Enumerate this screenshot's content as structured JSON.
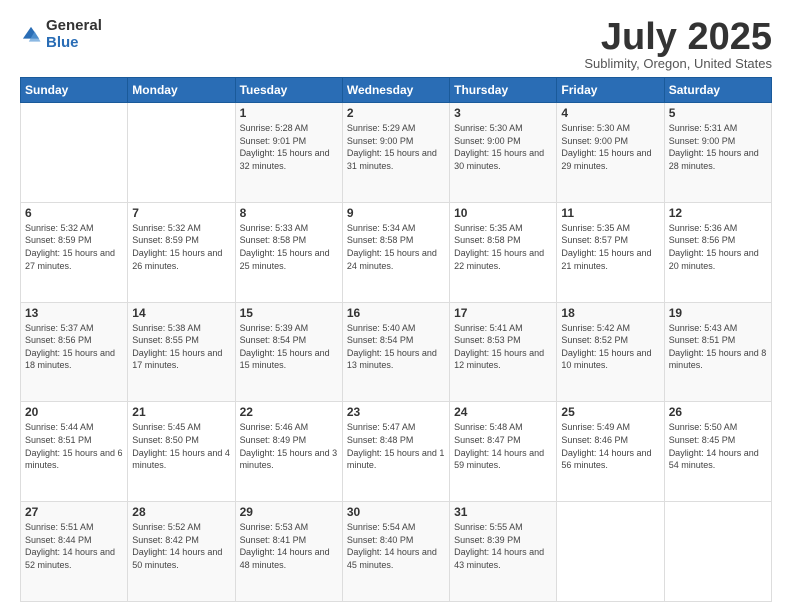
{
  "header": {
    "logo_general": "General",
    "logo_blue": "Blue",
    "month": "July 2025",
    "location": "Sublimity, Oregon, United States"
  },
  "days_of_week": [
    "Sunday",
    "Monday",
    "Tuesday",
    "Wednesday",
    "Thursday",
    "Friday",
    "Saturday"
  ],
  "weeks": [
    [
      {
        "day": "",
        "sunrise": "",
        "sunset": "",
        "daylight": ""
      },
      {
        "day": "",
        "sunrise": "",
        "sunset": "",
        "daylight": ""
      },
      {
        "day": "1",
        "sunrise": "Sunrise: 5:28 AM",
        "sunset": "Sunset: 9:01 PM",
        "daylight": "Daylight: 15 hours and 32 minutes."
      },
      {
        "day": "2",
        "sunrise": "Sunrise: 5:29 AM",
        "sunset": "Sunset: 9:00 PM",
        "daylight": "Daylight: 15 hours and 31 minutes."
      },
      {
        "day": "3",
        "sunrise": "Sunrise: 5:30 AM",
        "sunset": "Sunset: 9:00 PM",
        "daylight": "Daylight: 15 hours and 30 minutes."
      },
      {
        "day": "4",
        "sunrise": "Sunrise: 5:30 AM",
        "sunset": "Sunset: 9:00 PM",
        "daylight": "Daylight: 15 hours and 29 minutes."
      },
      {
        "day": "5",
        "sunrise": "Sunrise: 5:31 AM",
        "sunset": "Sunset: 9:00 PM",
        "daylight": "Daylight: 15 hours and 28 minutes."
      }
    ],
    [
      {
        "day": "6",
        "sunrise": "Sunrise: 5:32 AM",
        "sunset": "Sunset: 8:59 PM",
        "daylight": "Daylight: 15 hours and 27 minutes."
      },
      {
        "day": "7",
        "sunrise": "Sunrise: 5:32 AM",
        "sunset": "Sunset: 8:59 PM",
        "daylight": "Daylight: 15 hours and 26 minutes."
      },
      {
        "day": "8",
        "sunrise": "Sunrise: 5:33 AM",
        "sunset": "Sunset: 8:58 PM",
        "daylight": "Daylight: 15 hours and 25 minutes."
      },
      {
        "day": "9",
        "sunrise": "Sunrise: 5:34 AM",
        "sunset": "Sunset: 8:58 PM",
        "daylight": "Daylight: 15 hours and 24 minutes."
      },
      {
        "day": "10",
        "sunrise": "Sunrise: 5:35 AM",
        "sunset": "Sunset: 8:58 PM",
        "daylight": "Daylight: 15 hours and 22 minutes."
      },
      {
        "day": "11",
        "sunrise": "Sunrise: 5:35 AM",
        "sunset": "Sunset: 8:57 PM",
        "daylight": "Daylight: 15 hours and 21 minutes."
      },
      {
        "day": "12",
        "sunrise": "Sunrise: 5:36 AM",
        "sunset": "Sunset: 8:56 PM",
        "daylight": "Daylight: 15 hours and 20 minutes."
      }
    ],
    [
      {
        "day": "13",
        "sunrise": "Sunrise: 5:37 AM",
        "sunset": "Sunset: 8:56 PM",
        "daylight": "Daylight: 15 hours and 18 minutes."
      },
      {
        "day": "14",
        "sunrise": "Sunrise: 5:38 AM",
        "sunset": "Sunset: 8:55 PM",
        "daylight": "Daylight: 15 hours and 17 minutes."
      },
      {
        "day": "15",
        "sunrise": "Sunrise: 5:39 AM",
        "sunset": "Sunset: 8:54 PM",
        "daylight": "Daylight: 15 hours and 15 minutes."
      },
      {
        "day": "16",
        "sunrise": "Sunrise: 5:40 AM",
        "sunset": "Sunset: 8:54 PM",
        "daylight": "Daylight: 15 hours and 13 minutes."
      },
      {
        "day": "17",
        "sunrise": "Sunrise: 5:41 AM",
        "sunset": "Sunset: 8:53 PM",
        "daylight": "Daylight: 15 hours and 12 minutes."
      },
      {
        "day": "18",
        "sunrise": "Sunrise: 5:42 AM",
        "sunset": "Sunset: 8:52 PM",
        "daylight": "Daylight: 15 hours and 10 minutes."
      },
      {
        "day": "19",
        "sunrise": "Sunrise: 5:43 AM",
        "sunset": "Sunset: 8:51 PM",
        "daylight": "Daylight: 15 hours and 8 minutes."
      }
    ],
    [
      {
        "day": "20",
        "sunrise": "Sunrise: 5:44 AM",
        "sunset": "Sunset: 8:51 PM",
        "daylight": "Daylight: 15 hours and 6 minutes."
      },
      {
        "day": "21",
        "sunrise": "Sunrise: 5:45 AM",
        "sunset": "Sunset: 8:50 PM",
        "daylight": "Daylight: 15 hours and 4 minutes."
      },
      {
        "day": "22",
        "sunrise": "Sunrise: 5:46 AM",
        "sunset": "Sunset: 8:49 PM",
        "daylight": "Daylight: 15 hours and 3 minutes."
      },
      {
        "day": "23",
        "sunrise": "Sunrise: 5:47 AM",
        "sunset": "Sunset: 8:48 PM",
        "daylight": "Daylight: 15 hours and 1 minute."
      },
      {
        "day": "24",
        "sunrise": "Sunrise: 5:48 AM",
        "sunset": "Sunset: 8:47 PM",
        "daylight": "Daylight: 14 hours and 59 minutes."
      },
      {
        "day": "25",
        "sunrise": "Sunrise: 5:49 AM",
        "sunset": "Sunset: 8:46 PM",
        "daylight": "Daylight: 14 hours and 56 minutes."
      },
      {
        "day": "26",
        "sunrise": "Sunrise: 5:50 AM",
        "sunset": "Sunset: 8:45 PM",
        "daylight": "Daylight: 14 hours and 54 minutes."
      }
    ],
    [
      {
        "day": "27",
        "sunrise": "Sunrise: 5:51 AM",
        "sunset": "Sunset: 8:44 PM",
        "daylight": "Daylight: 14 hours and 52 minutes."
      },
      {
        "day": "28",
        "sunrise": "Sunrise: 5:52 AM",
        "sunset": "Sunset: 8:42 PM",
        "daylight": "Daylight: 14 hours and 50 minutes."
      },
      {
        "day": "29",
        "sunrise": "Sunrise: 5:53 AM",
        "sunset": "Sunset: 8:41 PM",
        "daylight": "Daylight: 14 hours and 48 minutes."
      },
      {
        "day": "30",
        "sunrise": "Sunrise: 5:54 AM",
        "sunset": "Sunset: 8:40 PM",
        "daylight": "Daylight: 14 hours and 45 minutes."
      },
      {
        "day": "31",
        "sunrise": "Sunrise: 5:55 AM",
        "sunset": "Sunset: 8:39 PM",
        "daylight": "Daylight: 14 hours and 43 minutes."
      },
      {
        "day": "",
        "sunrise": "",
        "sunset": "",
        "daylight": ""
      },
      {
        "day": "",
        "sunrise": "",
        "sunset": "",
        "daylight": ""
      }
    ]
  ]
}
